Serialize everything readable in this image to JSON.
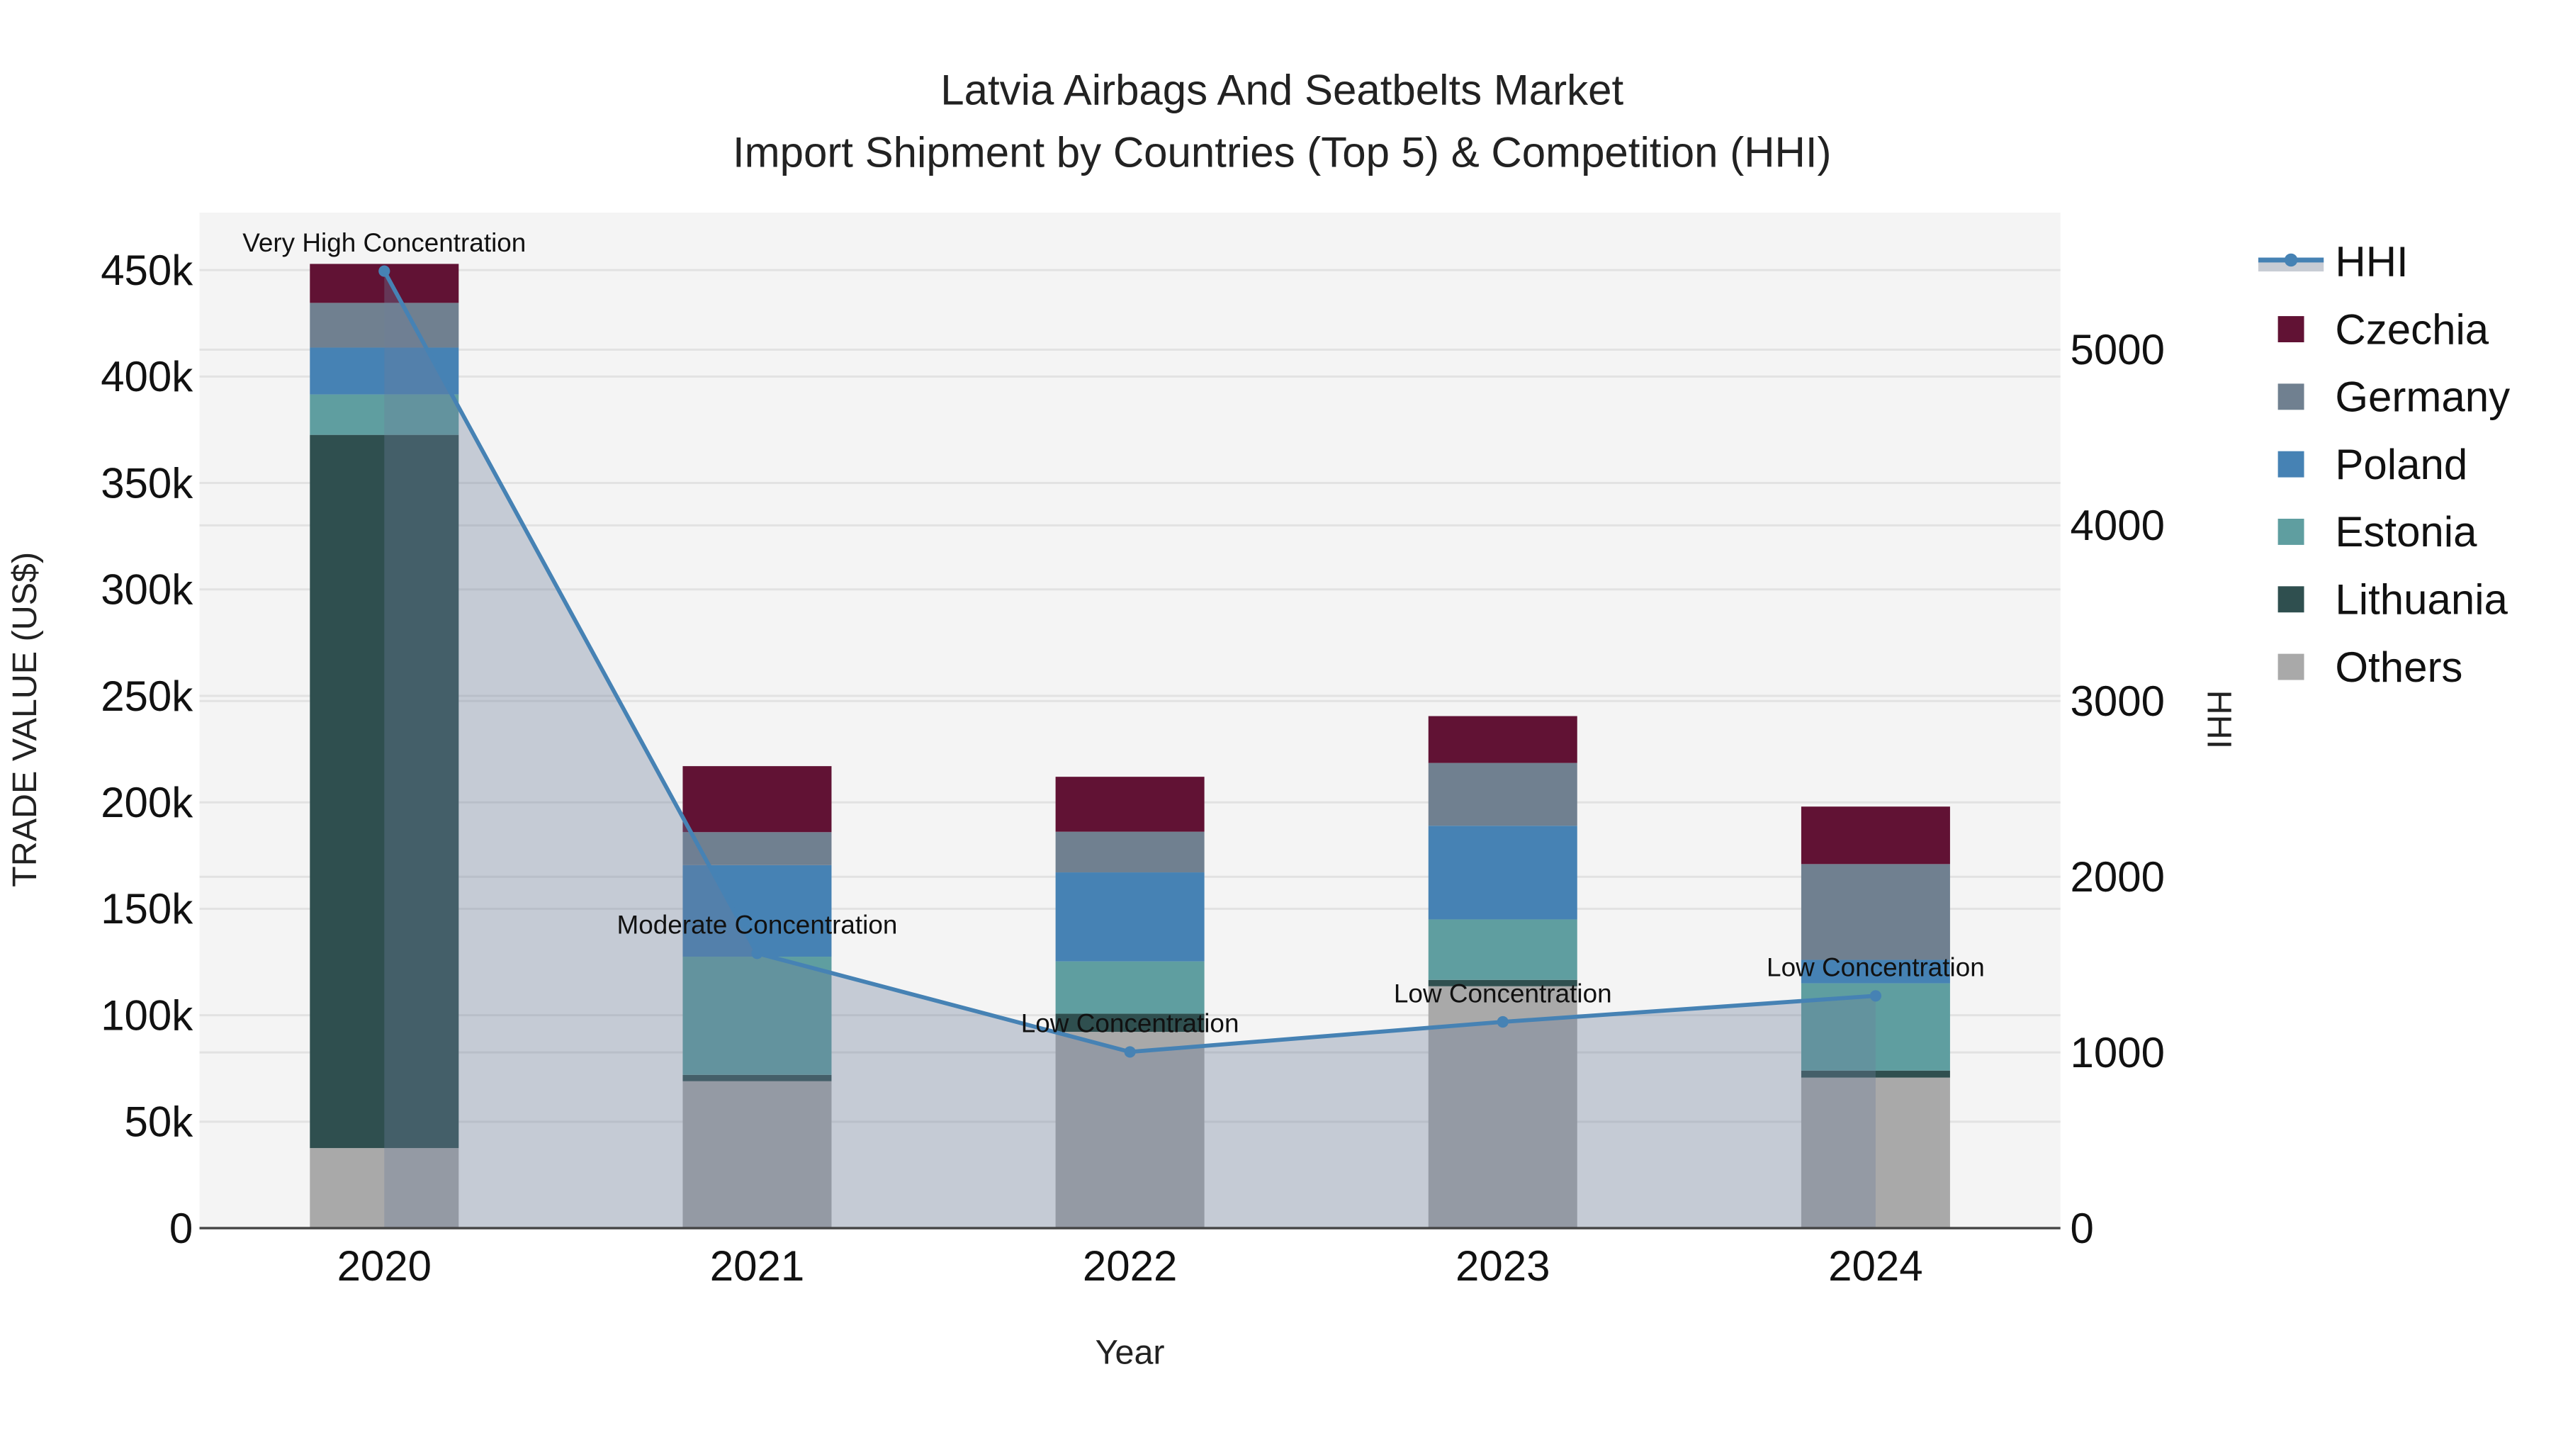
{
  "chart_data": {
    "type": "bar",
    "stacked": true,
    "title_line1": "Latvia Airbags And Seatbelts Market",
    "title_line2": "Import Shipment by Countries (Top 5) & Competition (HHI)",
    "xlabel": "Year",
    "ylabel": "TRADE VALUE (US$)",
    "y2label": "HHI",
    "categories": [
      "2020",
      "2021",
      "2022",
      "2023",
      "2024"
    ],
    "ylim": [
      0,
      477000
    ],
    "y2lim": [
      0,
      5780
    ],
    "yticks": [
      0,
      50000,
      100000,
      150000,
      200000,
      250000,
      300000,
      350000,
      400000,
      450000
    ],
    "ytick_labels": [
      "0",
      "50k",
      "100k",
      "150k",
      "200k",
      "250k",
      "300k",
      "350k",
      "400k",
      "450k"
    ],
    "y2ticks": [
      0,
      1000,
      2000,
      3000,
      4000,
      5000
    ],
    "y2tick_labels": [
      "0",
      "1000",
      "2000",
      "3000",
      "4000",
      "5000"
    ],
    "series": [
      {
        "name": "Others",
        "color": "#a9a9a9",
        "values": [
          37600,
          69000,
          92200,
          113600,
          70700
        ]
      },
      {
        "name": "Lithuania",
        "color": "#2f4f4f",
        "values": [
          335000,
          3000,
          8500,
          3000,
          3300
        ]
      },
      {
        "name": "Estonia",
        "color": "#5f9ea0",
        "values": [
          19000,
          55500,
          24600,
          28400,
          41000
        ]
      },
      {
        "name": "Poland",
        "color": "#4682b4",
        "values": [
          22000,
          43000,
          41800,
          44000,
          11000
        ]
      },
      {
        "name": "Germany",
        "color": "#708090",
        "values": [
          21000,
          15500,
          19100,
          29500,
          45000
        ]
      },
      {
        "name": "Czechia",
        "color": "#611234",
        "values": [
          18300,
          31000,
          25800,
          22000,
          27000
        ]
      }
    ],
    "hhi": {
      "name": "HHI",
      "color": "#4682b4",
      "values": [
        5447,
        1564,
        1003,
        1174,
        1322
      ],
      "annotations": [
        "Very High Concentration",
        "Moderate Concentration",
        "Low Concentration",
        "Low Concentration",
        "Low Concentration"
      ]
    },
    "legend_order": [
      "HHI",
      "Czechia",
      "Germany",
      "Poland",
      "Estonia",
      "Lithuania",
      "Others"
    ],
    "legend_position": "right",
    "grid": true
  }
}
